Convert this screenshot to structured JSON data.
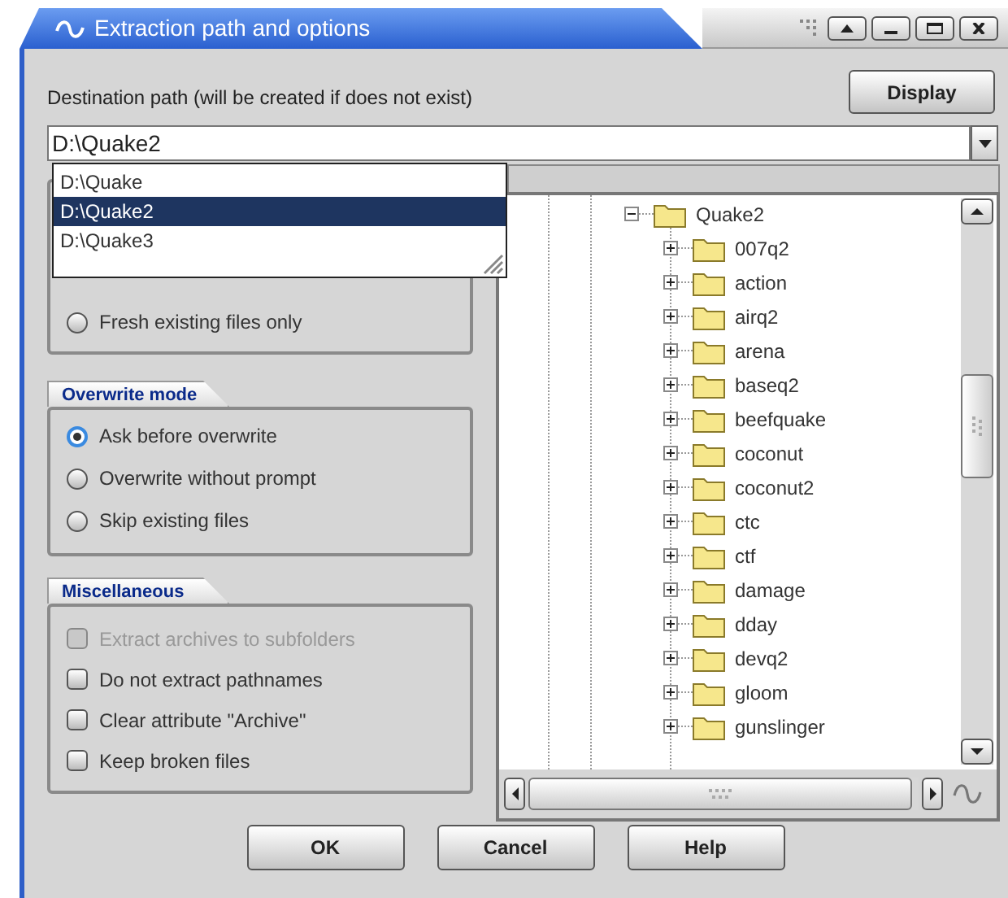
{
  "window": {
    "title": "Extraction path and options"
  },
  "destination": {
    "label": "Destination path (will be created if does not exist)",
    "value": "D:\\Quake2",
    "display_button": "Display",
    "dropdown": [
      {
        "label": "D:\\Quake",
        "selected": false
      },
      {
        "label": "D:\\Quake2",
        "selected": true
      },
      {
        "label": "D:\\Quake3",
        "selected": false
      }
    ]
  },
  "update_mode": {
    "options": [
      {
        "label": "Fresh existing files only",
        "selected": false
      }
    ]
  },
  "overwrite_mode": {
    "title": "Overwrite mode",
    "options": [
      {
        "label": "Ask before overwrite",
        "selected": true
      },
      {
        "label": "Overwrite without prompt",
        "selected": false
      },
      {
        "label": "Skip existing files",
        "selected": false
      }
    ]
  },
  "miscellaneous": {
    "title": "Miscellaneous",
    "options": [
      {
        "label": "Extract archives to subfolders",
        "checked": false,
        "disabled": true
      },
      {
        "label": "Do not extract pathnames",
        "checked": false,
        "disabled": false
      },
      {
        "label": "Clear attribute \"Archive\"",
        "checked": false,
        "disabled": false
      },
      {
        "label": "Keep broken files",
        "checked": false,
        "disabled": false
      }
    ]
  },
  "folder_tree": {
    "label": "Quake2",
    "expanded": true,
    "children": [
      {
        "label": "007q2",
        "expanded": false
      },
      {
        "label": "action",
        "expanded": false
      },
      {
        "label": "airq2",
        "expanded": false
      },
      {
        "label": "arena",
        "expanded": false
      },
      {
        "label": "baseq2",
        "expanded": false
      },
      {
        "label": "beefquake",
        "expanded": false
      },
      {
        "label": "coconut",
        "expanded": false
      },
      {
        "label": "coconut2",
        "expanded": false
      },
      {
        "label": "ctc",
        "expanded": false
      },
      {
        "label": "ctf",
        "expanded": false
      },
      {
        "label": "damage",
        "expanded": false
      },
      {
        "label": "dday",
        "expanded": false
      },
      {
        "label": "devq2",
        "expanded": false
      },
      {
        "label": "gloom",
        "expanded": false
      },
      {
        "label": "gunslinger",
        "expanded": false
      }
    ]
  },
  "buttons": [
    "OK",
    "Cancel",
    "Help"
  ]
}
